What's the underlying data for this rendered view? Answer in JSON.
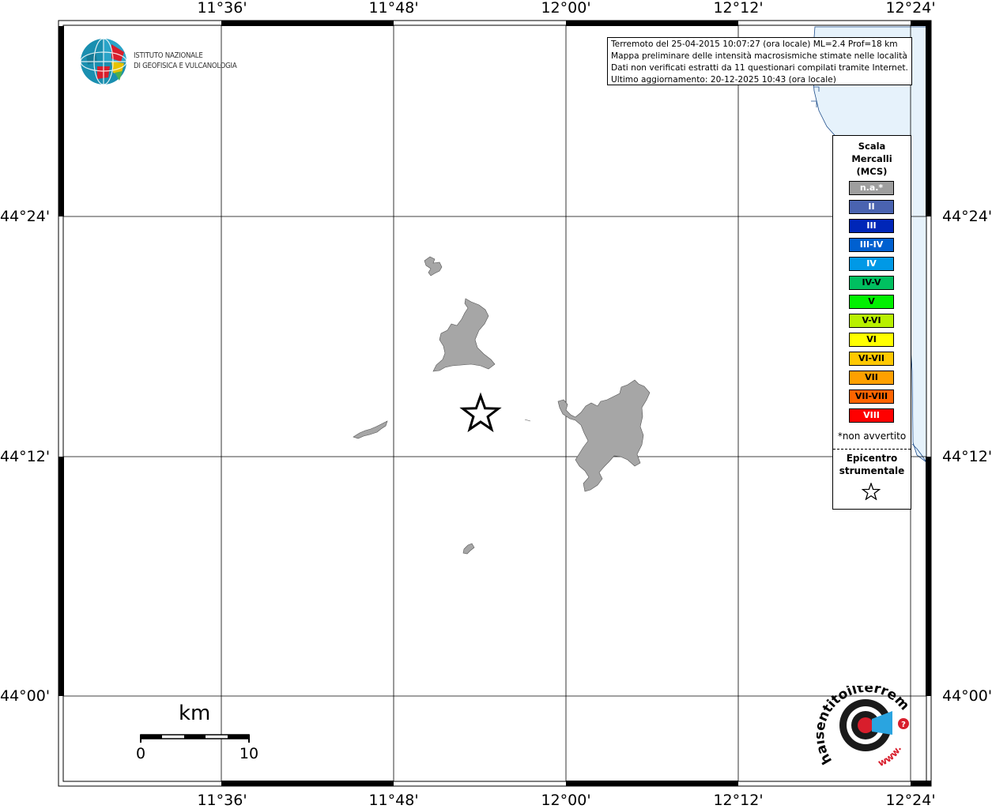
{
  "map": {
    "lon_labels_top": [
      "11°36'",
      "11°48'",
      "12°00'",
      "12°12'",
      "12°24'"
    ],
    "lon_labels_bottom": [
      "11°36'",
      "11°48'",
      "12°00'",
      "12°12'",
      "12°24'"
    ],
    "lat_labels_left": [
      "44°24'",
      "44°12'",
      "44°00'"
    ],
    "lat_labels_right": [
      "44°24'",
      "44°12'",
      "44°00'"
    ],
    "land_color": "#a6a6a6",
    "sea_color": "#e6f2fb",
    "epicenter_symbol": "star-outline"
  },
  "info": {
    "line1": "Terremoto del 25-04-2015 10:07:27 (ora locale) ML=2.4 Prof=18 km",
    "line2": "Mappa preliminare delle intensità macrosismiche stimate nelle località",
    "line3": "Dati non verificati estratti da 11 questionari compilati tramite Internet.",
    "line4": "Ultimo aggiornamento: 20-12-2025 10:43 (ora locale)"
  },
  "institute": {
    "name_line1": "ISTITUTO NAZIONALE",
    "name_line2": "DI GEOFISICA E VULCANOLOGIA"
  },
  "legend": {
    "title_line1": "Scala",
    "title_line2": "Mercalli",
    "title_line3": "(MCS)",
    "items": [
      {
        "label": "n.a.*",
        "color": "#9e9e9e",
        "text_color": "#ffffff"
      },
      {
        "label": "II",
        "color": "#4a63b0",
        "text_color": "#ffffff"
      },
      {
        "label": "III",
        "color": "#0026b8",
        "text_color": "#ffffff"
      },
      {
        "label": "III-IV",
        "color": "#0060d0",
        "text_color": "#ffffff"
      },
      {
        "label": "IV",
        "color": "#0099e6",
        "text_color": "#ffffff"
      },
      {
        "label": "IV-V",
        "color": "#00c060",
        "text_color": "#000000"
      },
      {
        "label": "V",
        "color": "#00f000",
        "text_color": "#000000"
      },
      {
        "label": "V-VI",
        "color": "#b8f000",
        "text_color": "#000000"
      },
      {
        "label": "VI",
        "color": "#ffff00",
        "text_color": "#000000"
      },
      {
        "label": "VI-VII",
        "color": "#ffc800",
        "text_color": "#000000"
      },
      {
        "label": "VII",
        "color": "#ffa000",
        "text_color": "#000000"
      },
      {
        "label": "VII-VIII",
        "color": "#ff6400",
        "text_color": "#000000"
      },
      {
        "label": "VIII",
        "color": "#ff0000",
        "text_color": "#ffffff"
      }
    ],
    "note": "*non avvertito",
    "epicenter_line1": "Epicentro",
    "epicenter_line2": "strumentale"
  },
  "scale_bar": {
    "unit": "km",
    "start_label": "0",
    "end_label": "10"
  },
  "hsit": {
    "text_main": "haisentitoilterremoto.it",
    "text_www": "www."
  }
}
